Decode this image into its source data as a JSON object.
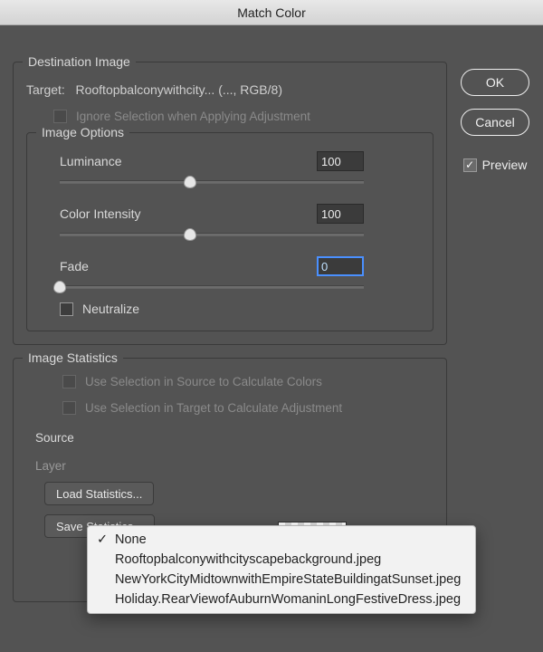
{
  "title": "Match Color",
  "buttons": {
    "ok": "OK",
    "cancel": "Cancel"
  },
  "preview": {
    "label": "Preview",
    "checked": true
  },
  "destination": {
    "group_title": "Destination Image",
    "target_label": "Target:",
    "target_value": "Rooftopbalconywithcity... (..., RGB/8)",
    "ignore_selection": "Ignore Selection when Applying Adjustment",
    "image_options_title": "Image Options",
    "luminance": {
      "label": "Luminance",
      "value": "100",
      "pos_pct": 43
    },
    "color_intensity": {
      "label": "Color Intensity",
      "value": "100",
      "pos_pct": 43
    },
    "fade": {
      "label": "Fade",
      "value": "0",
      "pos_pct": 0
    },
    "neutralize": "Neutralize"
  },
  "statistics": {
    "group_title": "Image Statistics",
    "use_sel_source": "Use Selection in Source to Calculate Colors",
    "use_sel_target": "Use Selection in Target to Calculate Adjustment",
    "source_label": "Source",
    "layer_label": "Layer",
    "load_btn": "Load Statistics...",
    "save_btn": "Save Statistics..."
  },
  "source_menu": {
    "items": [
      "None",
      "Rooftopbalconywithcityscapebackground.jpeg",
      "NewYorkCityMidtownwithEmpireStateBuildingatSunset.jpeg",
      "Holiday.RearViewofAuburnWomaninLongFestiveDress.jpeg"
    ],
    "selected_index": 0
  }
}
